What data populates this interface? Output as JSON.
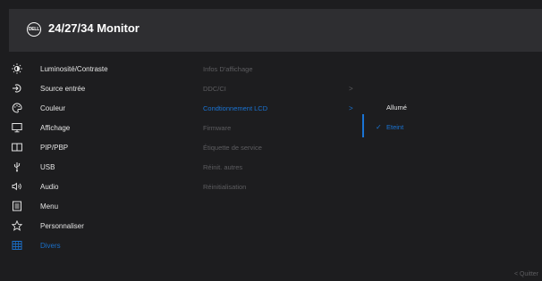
{
  "header": {
    "logo": "DELL",
    "title": "24/27/34 Monitor"
  },
  "menu": {
    "items": [
      {
        "label": "Luminosité/Contraste",
        "icon": "brightness-icon"
      },
      {
        "label": "Source entrée",
        "icon": "input-source-icon"
      },
      {
        "label": "Couleur",
        "icon": "color-icon"
      },
      {
        "label": "Affichage",
        "icon": "display-icon"
      },
      {
        "label": "PIP/PBP",
        "icon": "pip-icon"
      },
      {
        "label": "USB",
        "icon": "usb-icon"
      },
      {
        "label": "Audio",
        "icon": "audio-icon"
      },
      {
        "label": "Menu",
        "icon": "menu-icon"
      },
      {
        "label": "Personnaliser",
        "icon": "star-icon"
      },
      {
        "label": "Divers",
        "icon": "others-icon"
      }
    ],
    "active_index": 9
  },
  "submenu": {
    "items": [
      {
        "label": "Infos D'affichage"
      },
      {
        "label": "DDC/CI"
      },
      {
        "label": "Condtionnement LCD"
      },
      {
        "label": "Firmware"
      },
      {
        "label": "Étiquette de service"
      },
      {
        "label": "Réinit. autres"
      },
      {
        "label": "Réinitialisation"
      }
    ],
    "selected_index": 2
  },
  "options": {
    "on_label": "Allumé",
    "off_label": "Eteint",
    "selected": "Eteint"
  },
  "footer": {
    "quit_label": "< Quitter"
  },
  "colors": {
    "accent": "#1a74d4",
    "background": "#1d1d1f",
    "header": "#2e2e31",
    "dim_text": "#5d5d60"
  }
}
